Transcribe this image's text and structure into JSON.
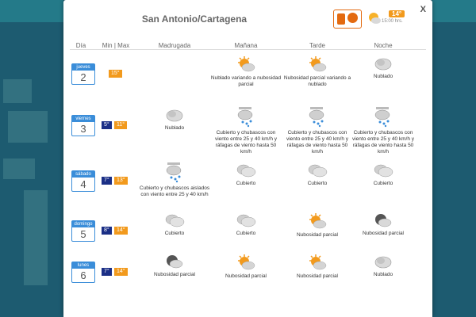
{
  "title": "San Antonio/Cartagena",
  "current": {
    "temp": "14°",
    "time": "15:00 hrs."
  },
  "close_label": "X",
  "headers": {
    "dia": "Día",
    "minmax": "Min | Max",
    "madrugada": "Madrugada",
    "manana": "Mañana",
    "tarde": "Tarde",
    "noche": "Noche"
  },
  "days": [
    {
      "name": "jueves",
      "num": "2",
      "min": "",
      "max": "15°",
      "cells": [
        null,
        {
          "icon": "partly-cloudy-sun",
          "label": "Nublado variando a nubosidad parcial"
        },
        {
          "icon": "partly-cloudy-sun",
          "label": "Nubosidad parcial variando a nublado"
        },
        {
          "icon": "cloudy-night",
          "label": "Nublado"
        }
      ]
    },
    {
      "name": "viernes",
      "num": "3",
      "min": "5°",
      "max": "11°",
      "cells": [
        {
          "icon": "cloudy-night",
          "label": "Nublado"
        },
        {
          "icon": "rain-wind",
          "label": "Cubierto y chubascos con viento entre 25 y 40 km/h y ráfagas de viento hasta 50 km/h"
        },
        {
          "icon": "rain-wind",
          "label": "Cubierto y chubascos con viento entre 25 y 40 km/h y ráfagas de viento hasta 50 km/h"
        },
        {
          "icon": "rain-wind",
          "label": "Cubierto y chubascos con viento entre 25 y 40 km/h y ráfagas de viento hasta 50 km/h"
        }
      ]
    },
    {
      "name": "sábado",
      "num": "4",
      "min": "7°",
      "max": "13°",
      "cells": [
        {
          "icon": "rain-wind",
          "label": "Cubierto y chubascos aislados con viento entre 25 y 40 km/h"
        },
        {
          "icon": "overcast",
          "label": "Cubierto"
        },
        {
          "icon": "overcast",
          "label": "Cubierto"
        },
        {
          "icon": "overcast",
          "label": "Cubierto"
        }
      ]
    },
    {
      "name": "domingo",
      "num": "5",
      "min": "8°",
      "max": "14°",
      "cells": [
        {
          "icon": "overcast",
          "label": "Cubierto"
        },
        {
          "icon": "overcast",
          "label": "Cubierto"
        },
        {
          "icon": "partly-cloudy-sun",
          "label": "Nubosidad parcial"
        },
        {
          "icon": "partly-cloudy-night",
          "label": "Nubosidad parcial"
        }
      ]
    },
    {
      "name": "lunes",
      "num": "6",
      "min": "7°",
      "max": "14°",
      "cells": [
        {
          "icon": "partly-cloudy-night",
          "label": "Nubosidad parcial"
        },
        {
          "icon": "partly-cloudy-sun",
          "label": "Nubosidad parcial"
        },
        {
          "icon": "partly-cloudy-sun",
          "label": "Nubosidad parcial"
        },
        {
          "icon": "cloudy-night",
          "label": "Nublado"
        }
      ]
    }
  ],
  "colors": {
    "accent_blue": "#3a8dd9",
    "min_bg": "#1b2f86",
    "max_bg": "#f29a1d",
    "sun": "#f29a1d"
  }
}
